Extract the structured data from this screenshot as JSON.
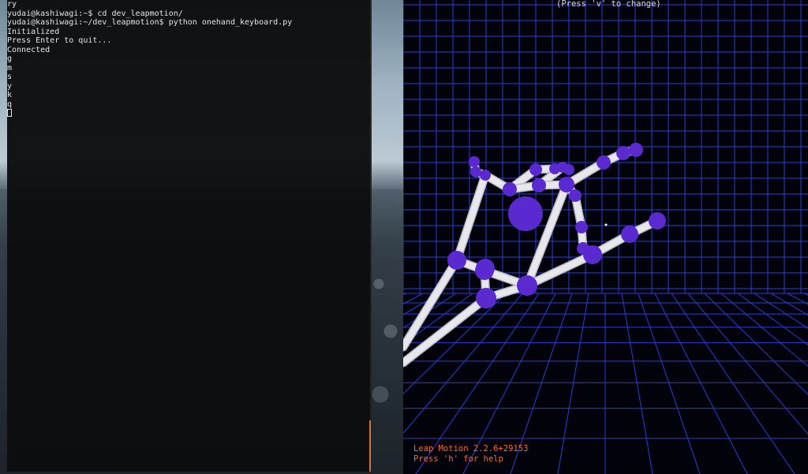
{
  "terminal": {
    "lines": [
      "ry",
      "yudai@kashiwagi:~$ cd dev_leapmotion/",
      "yudai@kashiwagi:~/dev_leapmotion$ python onehand_keyboard.py",
      "Initialized",
      "Press Enter to quit...",
      "Connected",
      "g",
      "m",
      "s",
      "y",
      "k",
      "q"
    ]
  },
  "visualizer": {
    "view_hint": "(Press 'v' to change)",
    "version": "Leap Motion 2.2.6+29153",
    "help_hint": "Press 'h' for help",
    "colors": {
      "grid": "#2a3ed8",
      "joint": "#5a2ad0",
      "bone": "#e8e8ec",
      "overlay_text": "#ff6a2a"
    }
  }
}
